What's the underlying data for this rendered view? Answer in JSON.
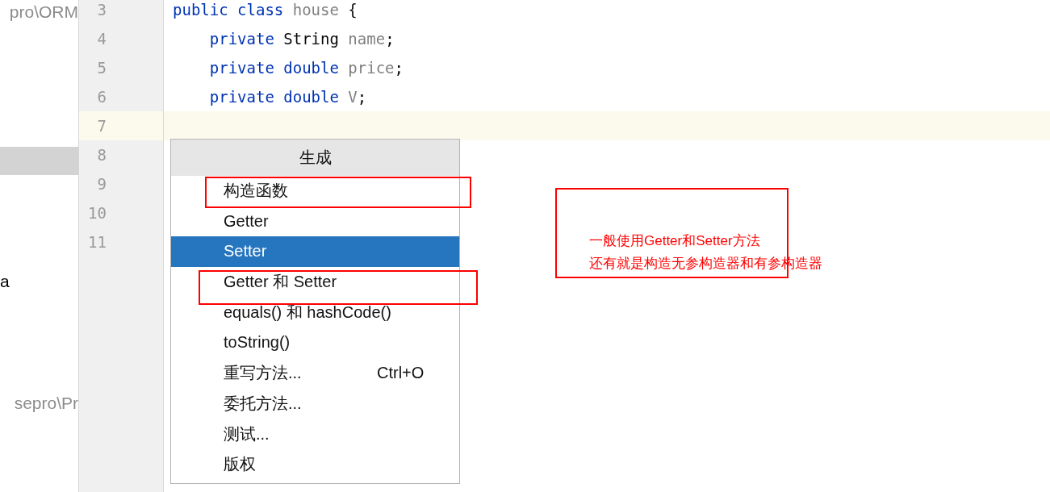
{
  "sidebar": {
    "items": [
      {
        "label": "pro\\ORM",
        "kind": "path"
      },
      {
        "label": "a",
        "kind": "file"
      },
      {
        "label": "sepro\\Pr",
        "kind": "path"
      }
    ]
  },
  "editor": {
    "lines": [
      {
        "number": "3",
        "current": false,
        "tokens": [
          {
            "text": "public class ",
            "kind": "keyword"
          },
          {
            "text": "house ",
            "kind": "ident"
          },
          {
            "text": "{",
            "kind": "plain"
          }
        ]
      },
      {
        "number": "4",
        "current": false,
        "tokens": [
          {
            "text": "    private ",
            "kind": "keyword"
          },
          {
            "text": "String ",
            "kind": "plain"
          },
          {
            "text": "name",
            "kind": "ident"
          },
          {
            "text": ";",
            "kind": "plain"
          }
        ]
      },
      {
        "number": "5",
        "current": false,
        "tokens": [
          {
            "text": "    private double ",
            "kind": "keyword"
          },
          {
            "text": "price",
            "kind": "ident"
          },
          {
            "text": ";",
            "kind": "plain"
          }
        ]
      },
      {
        "number": "6",
        "current": false,
        "tokens": [
          {
            "text": "    private double ",
            "kind": "keyword"
          },
          {
            "text": "V",
            "kind": "ident"
          },
          {
            "text": ";",
            "kind": "plain"
          }
        ]
      },
      {
        "number": "7",
        "current": true
      },
      {
        "number": "8",
        "current": false
      },
      {
        "number": "9",
        "current": false
      },
      {
        "number": "10",
        "current": false
      },
      {
        "number": "11",
        "current": false
      }
    ]
  },
  "generate_menu": {
    "title": "生成",
    "items": [
      {
        "label": "构造函数",
        "selected": false,
        "marked": true
      },
      {
        "label": "Getter",
        "selected": false,
        "marked": false
      },
      {
        "label": "Setter",
        "selected": true,
        "marked": false
      },
      {
        "label": "Getter 和 Setter",
        "selected": false,
        "marked": true
      },
      {
        "label": "equals() 和 hashCode()",
        "selected": false,
        "marked": false
      },
      {
        "label": "toString()",
        "selected": false,
        "marked": false
      },
      {
        "label": "重写方法...",
        "shortcut": "Ctrl+O",
        "selected": false,
        "marked": false
      },
      {
        "label": "委托方法...",
        "selected": false,
        "marked": false
      },
      {
        "label": "测试...",
        "selected": false,
        "marked": false
      },
      {
        "label": "版权",
        "selected": false,
        "marked": false
      }
    ]
  },
  "note": {
    "lines": [
      "一般使用Getter和Setter方法",
      "还有就是构造无参构造器和有参构造器"
    ]
  }
}
